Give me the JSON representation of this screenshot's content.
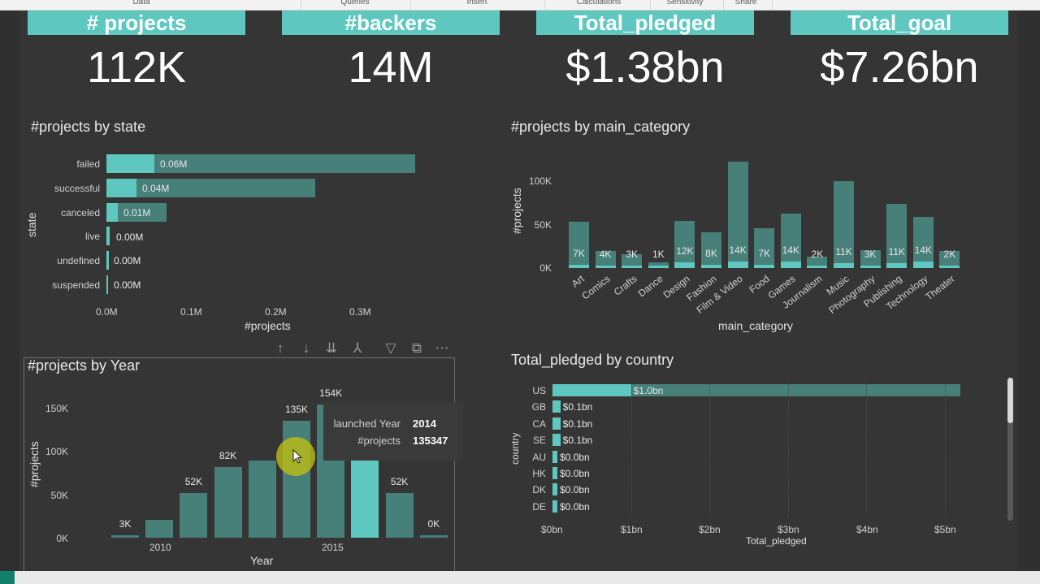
{
  "ribbon": {
    "groups": [
      "Data",
      "Queries",
      "Insert",
      "Calculations",
      "Sensitivity",
      "Share"
    ]
  },
  "kpis": [
    {
      "title": "# projects",
      "value": "112K"
    },
    {
      "title": "#backers",
      "value": "14M"
    },
    {
      "title": "Total_pledged",
      "value": "$1.38bn"
    },
    {
      "title": "Total_goal",
      "value": "$7.26bn"
    }
  ],
  "colors": {
    "accent": "#5ec8c0",
    "bar_muted": "#477f79",
    "canvas": "#353535"
  },
  "chart_state": {
    "title": "#projects by state",
    "ylabel": "state",
    "xlabel": "#projects",
    "categories": [
      "failed",
      "successful",
      "canceled",
      "live",
      "undefined",
      "suspended"
    ],
    "data_labels": [
      "0.06M",
      "0.04M",
      "0.01M",
      "0.00M",
      "0.00M",
      "0.00M"
    ],
    "xticks": [
      "0.0M",
      "0.1M",
      "0.2M",
      "0.3M"
    ]
  },
  "chart_category": {
    "title": "#projects by main_category",
    "ylabel": "#projects",
    "xlabel": "main_category",
    "yticks": [
      "100K",
      "50K",
      "0K"
    ],
    "categories": [
      "Art",
      "Comics",
      "Crafts",
      "Dance",
      "Design",
      "Fashion",
      "Film & Video",
      "Food",
      "Games",
      "Journalism",
      "Music",
      "Photography",
      "Publishing",
      "Technology",
      "Theater"
    ],
    "data_labels": [
      "7K",
      "4K",
      "3K",
      "1K",
      "12K",
      "8K",
      "14K",
      "7K",
      "14K",
      "2K",
      "11K",
      "3K",
      "11K",
      "14K",
      "2K"
    ]
  },
  "chart_year": {
    "title": "#projects by Year",
    "ylabel": "#projects",
    "xlabel": "Year",
    "yticks": [
      "150K",
      "100K",
      "50K",
      "0K"
    ],
    "xticks": [
      "2010",
      "2015"
    ],
    "data_labels": [
      "3K",
      "",
      "52K",
      "82K",
      "",
      "135K",
      "154K",
      "",
      "52K",
      "0K"
    ],
    "tooltip": {
      "k1": "launched Year",
      "v1": "2014",
      "k2": "#projects",
      "v2": "135347"
    }
  },
  "chart_country": {
    "title": "Total_pledged by country",
    "ylabel": "country",
    "xlabel": "Total_pledged",
    "categories": [
      "US",
      "GB",
      "CA",
      "SE",
      "AU",
      "HK",
      "DK",
      "DE"
    ],
    "data_labels": [
      "$1.0bn",
      "$0.1bn",
      "$0.1bn",
      "$0.1bn",
      "$0.0bn",
      "$0.0bn",
      "$0.0bn",
      "$0.0bn"
    ],
    "xticks": [
      "$0bn",
      "$1bn",
      "$2bn",
      "$3bn",
      "$4bn",
      "$5bn"
    ]
  },
  "toolbar": {
    "icons": [
      "arrow-up-icon",
      "arrow-down-icon",
      "double-arrow-down-icon",
      "expand-hierarchy-icon",
      "filter-icon",
      "focus-mode-icon",
      "more-options-icon"
    ]
  },
  "chart_data": [
    {
      "type": "bar",
      "title": "#projects by state",
      "xlabel": "#projects",
      "ylabel": "state",
      "categories": [
        "failed",
        "successful",
        "canceled",
        "live",
        "undefined",
        "suspended"
      ],
      "series": [
        {
          "values": [
            0.06,
            0.04,
            0.01,
            0.002,
            0.001,
            0.0005
          ]
        },
        {
          "values": [
            0.355,
            0.24,
            0.07,
            0.004,
            0.003,
            0.002
          ]
        }
      ],
      "xlim": [
        0,
        0.35
      ]
    },
    {
      "type": "bar",
      "title": "#projects by main_category",
      "xlabel": "main_category",
      "ylabel": "#projects",
      "categories": [
        "Art",
        "Comics",
        "Crafts",
        "Dance",
        "Design",
        "Fashion",
        "Film & Video",
        "Food",
        "Games",
        "Journalism",
        "Music",
        "Photography",
        "Publishing",
        "Technology",
        "Theater"
      ],
      "series": [
        {
          "values": [
            7,
            4,
            3,
            1,
            12,
            8,
            14,
            7,
            14,
            2,
            11,
            3,
            11,
            14,
            2
          ]
        },
        {
          "values": [
            53,
            20,
            16,
            7,
            54,
            41,
            122,
            46,
            63,
            13,
            100,
            21,
            74,
            59,
            20
          ]
        }
      ],
      "ylim": [
        0,
        125
      ]
    },
    {
      "type": "bar",
      "title": "#projects by Year",
      "xlabel": "Year",
      "ylabel": "#projects",
      "categories": [
        "2009",
        "2010",
        "2011",
        "2012",
        "2013",
        "2014",
        "2015",
        "2016",
        "2017",
        "2018"
      ],
      "values": [
        3,
        21,
        52,
        82,
        89,
        135,
        154,
        89,
        52,
        0
      ],
      "ylim": [
        0,
        165
      ]
    },
    {
      "type": "bar",
      "title": "Total_pledged by country",
      "xlabel": "Total_pledged",
      "ylabel": "country",
      "categories": [
        "US",
        "GB",
        "CA",
        "SE",
        "AU",
        "HK",
        "DK",
        "DE"
      ],
      "series": [
        {
          "values": [
            1.0,
            0.1,
            0.1,
            0.1,
            0.0,
            0.0,
            0.0,
            0.0
          ]
        },
        {
          "values": [
            5.2,
            0.05,
            0.05,
            0.05,
            0.03,
            0.02,
            0.02,
            0.02
          ]
        }
      ],
      "xlim": [
        0,
        5.2
      ]
    }
  ]
}
